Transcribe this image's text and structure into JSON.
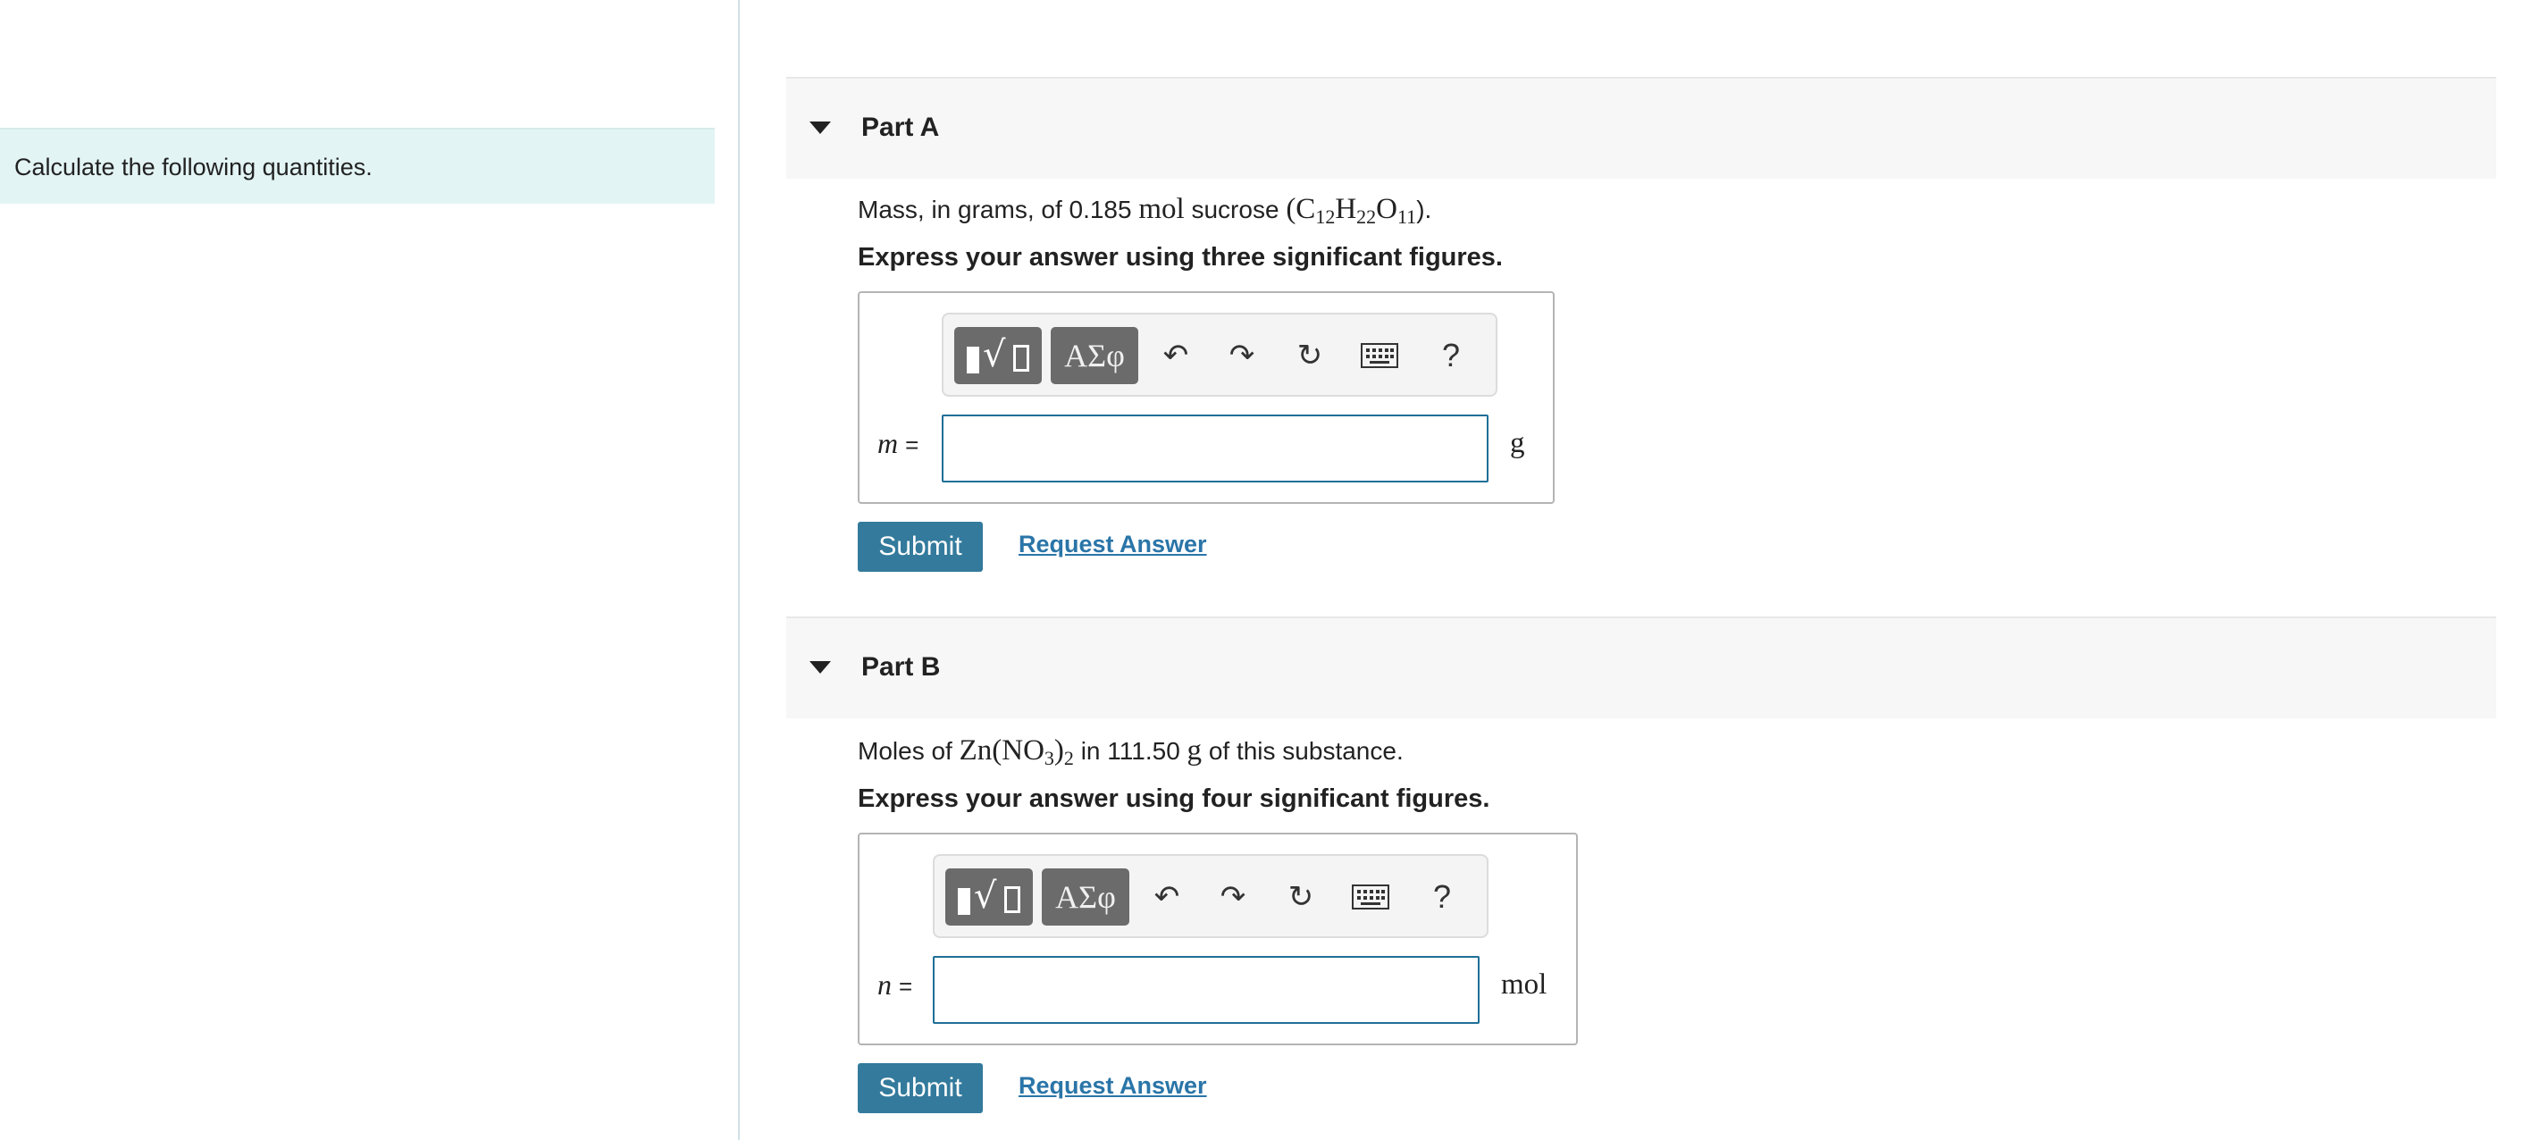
{
  "intro": {
    "text": "Calculate the following quantities."
  },
  "toolbar": {
    "template_icon": "template-sqrt-icon",
    "greek_label": "ΑΣφ",
    "undo_icon": "undo-icon",
    "redo_icon": "redo-icon",
    "reset_icon": "reset-icon",
    "keyboard_icon": "keyboard-icon",
    "help_label": "?"
  },
  "part_a": {
    "title": "Part A",
    "question": {
      "prefix": "Mass, in grams, of 0.185",
      "unit": "mol",
      "word": "sucrose",
      "formula_open": "(C",
      "sub1": "12",
      "h": "H",
      "sub2": "22",
      "o": "O",
      "sub3": "11",
      "formula_close": ")."
    },
    "instruction": "Express your answer using three significant figures.",
    "variable": "m",
    "equals": "=",
    "input_value": "",
    "unit": "g",
    "submit_label": "Submit",
    "request_label": "Request Answer"
  },
  "part_b": {
    "title": "Part B",
    "question": {
      "prefix": "Moles of",
      "formula_a": "Zn(NO",
      "sub1": "3",
      "formula_b": ")",
      "sub2": "2",
      "middle": "in 111.50",
      "unit": "g",
      "suffix": "of this substance."
    },
    "instruction": "Express your answer using four significant figures.",
    "variable": "n",
    "equals": "=",
    "input_value": "",
    "unit": "mol",
    "submit_label": "Submit",
    "request_label": "Request Answer"
  },
  "colors": {
    "submit_bg": "#337a9c",
    "link": "#2a75a8",
    "intro_bg": "#e3f4f4",
    "input_border": "#1f6f97"
  }
}
